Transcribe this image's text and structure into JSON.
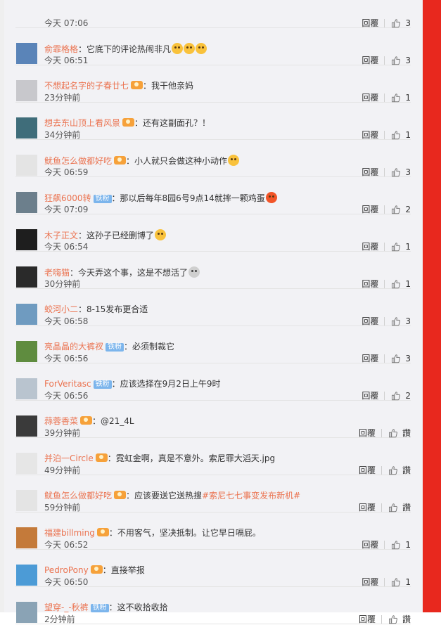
{
  "ui": {
    "reply_label": "回覆",
    "like_label": "讚",
    "fan_badge": "铁粉"
  },
  "comments": [
    {
      "user": "",
      "text": "",
      "time": "今天 07:06",
      "likes": "3"
    },
    {
      "user": "俞霏格格",
      "text": "：它底下的评论热闹非凡",
      "time": "今天 06:51",
      "likes": "3",
      "avatar_color": "#5a84b8",
      "emoji": [
        "laugh-cry-icon",
        "laugh-cry-icon",
        "laugh-cry-icon"
      ]
    },
    {
      "user": "不想起名字的子春廿七",
      "text": "：我干他亲妈",
      "time": "23分钟前",
      "likes": "1",
      "avatar_color": "#c8c8cc",
      "vip": true
    },
    {
      "user": "想去东山顶上看风景",
      "text": "：还有这副面孔？！",
      "time": "34分钟前",
      "likes": "1",
      "avatar_color": "#3f6d7a",
      "vip": true
    },
    {
      "user": "鱿鱼怎么做都好吃",
      "text": "：小人就只会做这种小动作",
      "time": "今天 06:59",
      "likes": "3",
      "avatar_color": "#e4e4e4",
      "vip": true,
      "emoji": [
        "angry-icon"
      ]
    },
    {
      "user": "狂飙6000转",
      "text": "：那以后每年8园6号9点14就摔一颗鸡蛋",
      "time": "今天 07:09",
      "likes": "2",
      "avatar_color": "#6c7f8c",
      "fan": true,
      "emoji": [
        "devil-icon"
      ]
    },
    {
      "user": "木子正文",
      "text": "：这孙子已经删博了",
      "time": "今天 06:54",
      "likes": "1",
      "avatar_color": "#1e1e1e",
      "emoji": [
        "secret-icon"
      ]
    },
    {
      "user": "老嗨猫",
      "text": "：今天弄这个事，这是不想活了",
      "time": "30分钟前",
      "likes": "1",
      "avatar_color": "#2a2a2a",
      "emoji": [
        "skull-icon"
      ]
    },
    {
      "user": "蛟河小二",
      "text": "：8-15发布更合适",
      "time": "今天 06:58",
      "likes": "3",
      "avatar_color": "#6f9bc0"
    },
    {
      "user": "亮晶晶的大裤衩",
      "text": "：必须制裁它",
      "time": "今天 06:56",
      "likes": "3",
      "avatar_color": "#5f8c3f",
      "fan": true
    },
    {
      "user": "ForVeritasc",
      "text": "：应该选择在9月2日上午9时",
      "time": "今天 06:56",
      "likes": "2",
      "avatar_color": "#b9c4cf",
      "fan": true
    },
    {
      "user": "蒜蓉香菜",
      "text": "：@21_4L",
      "time": "39分钟前",
      "likes": "讚",
      "avatar_color": "#3a3a3a",
      "vip": true,
      "text_link": true
    },
    {
      "user": "并泊一Circle",
      "text": "：霓虹金啊，真是不意外。索尼罪大滔天.jpg",
      "time": "49分钟前",
      "likes": "讚",
      "avatar_color": "#e6e6e6",
      "vip": true
    },
    {
      "user": "鱿鱼怎么做都好吃",
      "text": "：应该要送它送热搜",
      "hashtag": "#索尼七七事变发布新机#",
      "time": "59分钟前",
      "likes": "讚",
      "avatar_color": "#e4e4e4",
      "vip": true
    },
    {
      "user": "福建billming",
      "text": "：不用客气，坚决抵制。让它早日嗝屁。",
      "time": "今天 06:52",
      "likes": "1",
      "avatar_color": "#c47a3a",
      "vip": true
    },
    {
      "user": "PedroPony",
      "text": "：直接举报",
      "time": "今天 06:50",
      "likes": "1",
      "avatar_color": "#4c9bd6",
      "vip": true
    },
    {
      "user": "望穿-_-秋裤",
      "text": "：这不收拾收拾",
      "time": "2分钟前",
      "likes": "讚",
      "avatar_color": "#8aa3b5",
      "fan": true
    }
  ]
}
